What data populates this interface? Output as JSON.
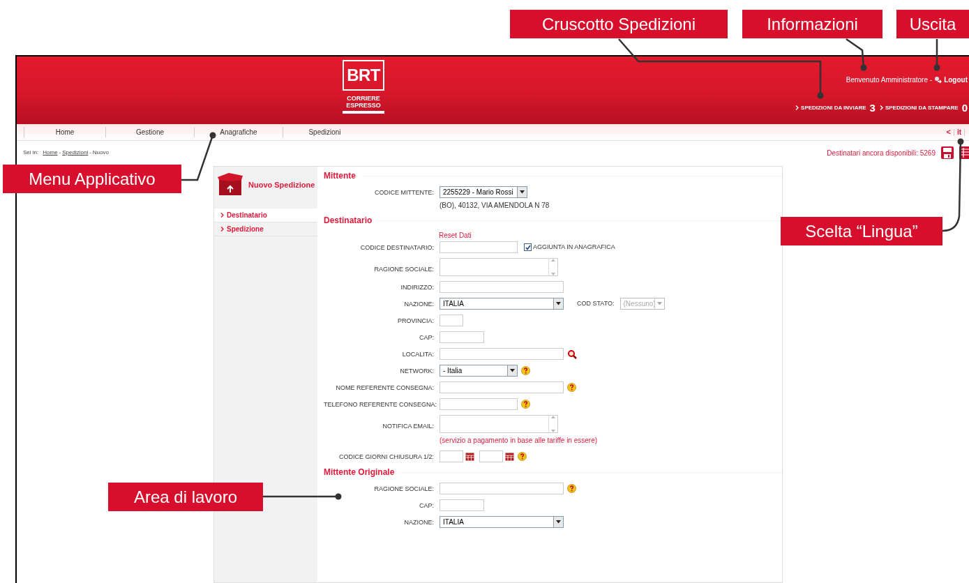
{
  "callouts": [
    {
      "label": "Cruscotto Spedizioni"
    },
    {
      "label": "Informazioni"
    },
    {
      "label": "Uscita"
    },
    {
      "label": "Menu Applicativo"
    },
    {
      "label": "Scelta “Lingua”"
    },
    {
      "label": "Area di lavoro"
    }
  ],
  "header": {
    "logo": {
      "mark": "BRT",
      "line1": "CORRIERE",
      "line2": "ESPRESSO"
    },
    "welcome": "Benvenuto Amministratore -",
    "logout": "Logout",
    "counters": [
      {
        "label": "SPEDIZIONI DA INVIARE",
        "count": "3"
      },
      {
        "label": "SPEDIZIONI DA STAMPARE",
        "count": "0"
      }
    ]
  },
  "nav": {
    "items": [
      "Home",
      "Gestione",
      "Anagrafiche",
      "Spedizioni"
    ],
    "back": "<",
    "language": "it"
  },
  "breadcrumb": {
    "prefix": "Sei in:",
    "links": [
      "Home",
      "Spedizioni"
    ],
    "separator": "-",
    "current": "Nuovo"
  },
  "availability": "Destinatari ancora disponibili: 5269",
  "sidebar": {
    "title": "Nuovo Spedizione",
    "items": [
      {
        "label": "Destinatario",
        "selected": true
      },
      {
        "label": "Spedizione",
        "selected": false
      }
    ]
  },
  "sections": [
    {
      "title": "Mittente",
      "rows": [
        {
          "kind": "select",
          "label": "CODICE MITTENTE:",
          "value": "2255229 - Mario Rossi",
          "note": "(BO), 40132, VIA AMENDOLA N 78"
        }
      ]
    },
    {
      "title": "Destinatario",
      "link": "Reset Dati",
      "rows": [
        {
          "kind": "text",
          "label": "CODICE DESTINATARIO:",
          "checkbox": {
            "label": "AGGIUNTA IN ANAGRAFICA",
            "checked": true
          }
        },
        {
          "kind": "textarea",
          "label": "RAGIONE SOCIALE:"
        },
        {
          "kind": "text",
          "label": "INDIRIZZO:"
        },
        {
          "kind": "select",
          "label": "NAZIONE:",
          "value": "ITALIA",
          "extra": {
            "label": "COD STATO:",
            "value": "(Nessuno)",
            "disabled": true
          }
        },
        {
          "kind": "text",
          "label": "PROVINCIA:"
        },
        {
          "kind": "text",
          "label": "CAP:"
        },
        {
          "kind": "text",
          "label": "LOCALITA:"
        },
        {
          "kind": "select",
          "label": "NETWORK:",
          "value": "- Italia"
        },
        {
          "kind": "text",
          "label": "NOME REFERENTE CONSEGNA:"
        },
        {
          "kind": "text",
          "label": "TELEFONO REFERENTE CONSEGNA:"
        },
        {
          "kind": "textarea",
          "label": "NOTIFICA EMAIL:",
          "note": "(servizio a pagamento in base alle tariffe in essere)"
        },
        {
          "kind": "dates",
          "label": "CODICE GIORNI CHIUSURA 1/2:"
        }
      ]
    },
    {
      "title": "Mittente Originale",
      "rows": [
        {
          "kind": "text",
          "label": "RAGIONE SOCIALE:"
        },
        {
          "kind": "text",
          "label": "CAP:"
        },
        {
          "kind": "select",
          "label": "NAZIONE:",
          "value": "ITALIA"
        }
      ]
    }
  ]
}
